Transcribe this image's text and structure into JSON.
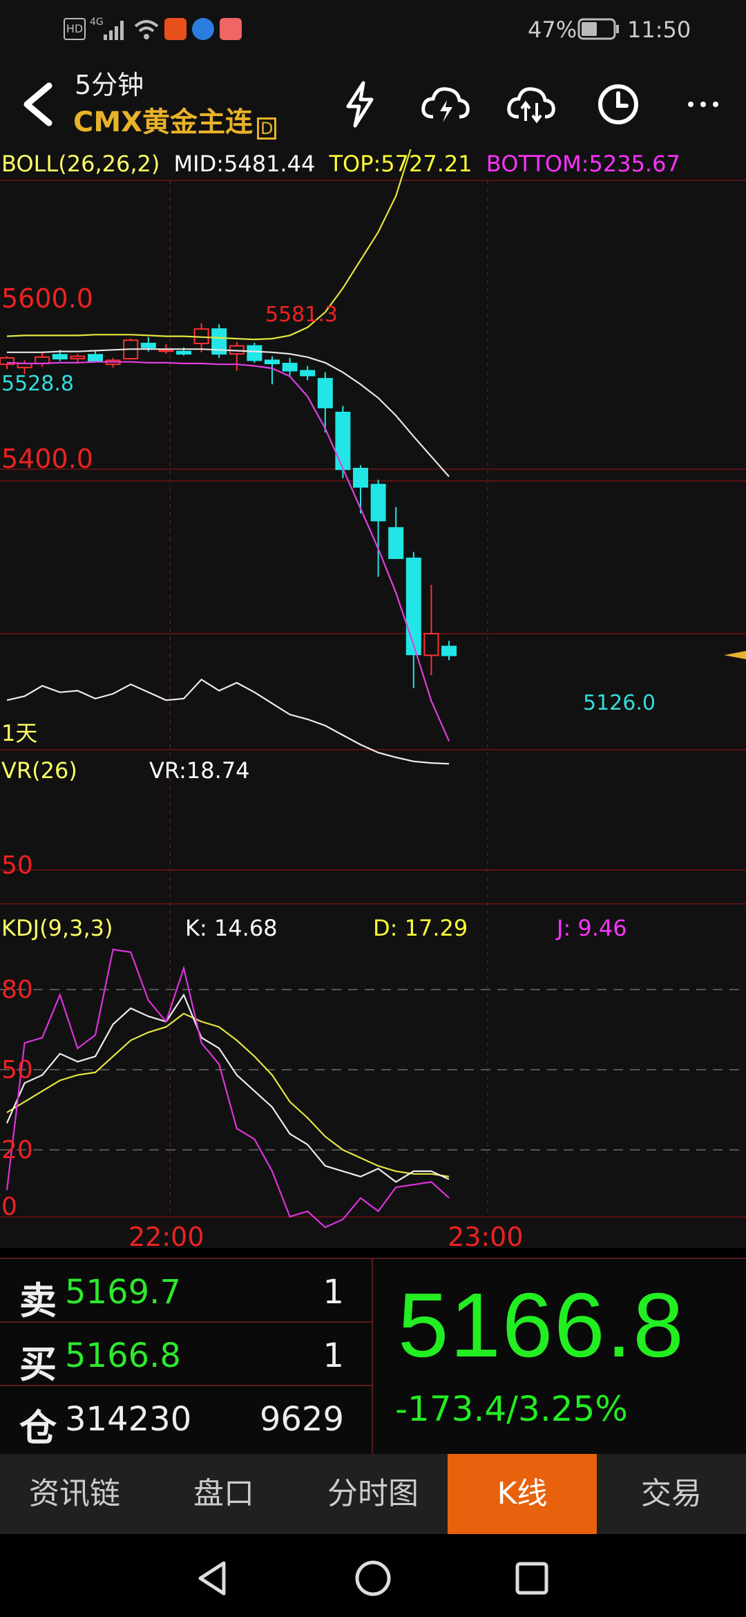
{
  "status_bar": {
    "left_icons": [
      "hd-icon",
      "signal-4g-icon",
      "wifi-icon",
      "app-notification-icon",
      "browser-icon",
      "app-icon"
    ],
    "battery": "47%",
    "time": "11:50"
  },
  "header": {
    "interval": "5分钟",
    "instrument": "CMX黄金主连",
    "badge": "D",
    "buttons": [
      "back-icon",
      "lightning-icon",
      "cloud-lightning-icon",
      "cloud-sync-icon",
      "clock-icon",
      "more-icon"
    ]
  },
  "boll": {
    "title": "BOLL(26,26,2)",
    "mid": "MID:5481.44",
    "top": "TOP:5727.21",
    "bottom": "BOTTOM:5235.67",
    "colors": {
      "title": "#ffff66",
      "mid": "#ffffff",
      "top": "#ffff33",
      "bottom": "#ff33ff"
    }
  },
  "price_axis": {
    "label_5600": "5600.0",
    "label_5400": "5400.0"
  },
  "annotations": {
    "high": "5581.3",
    "left": "5528.8",
    "low": "5126.0"
  },
  "period_label": "1天",
  "vr": {
    "title": "VR(26)",
    "value": "VR:18.74",
    "axis_label": "50"
  },
  "kdj": {
    "title": "KDJ(9,3,3)",
    "k": "K: 14.68",
    "d": "D: 17.29",
    "j": "J: 9.46",
    "axis": [
      "80",
      "50",
      "20",
      "0"
    ]
  },
  "time_axis": [
    "22:00",
    "23:00"
  ],
  "chart_data": {
    "type": "candlestick",
    "series": [
      {
        "name": "BOLL",
        "values": {
          "mid": 5481.44,
          "top": 5727.21,
          "bottom": 5235.67
        }
      },
      {
        "name": "VR",
        "values": {
          "VR": 18.74
        }
      },
      {
        "name": "KDJ",
        "values": {
          "K": 14.68,
          "D": 17.29,
          "J": 9.46
        }
      }
    ],
    "price_ticks": [
      5600.0,
      5400.0
    ],
    "kdj_ticks": [
      80,
      50,
      20,
      0
    ],
    "marked_high": 5581.3,
    "marked_low": 5126.0,
    "candles": [
      {
        "o": 5530,
        "h": 5540,
        "l": 5524,
        "c": 5538
      },
      {
        "o": 5526,
        "h": 5535,
        "l": 5518,
        "c": 5531
      },
      {
        "o": 5531,
        "h": 5545,
        "l": 5527,
        "c": 5539
      },
      {
        "o": 5542,
        "h": 5548,
        "l": 5534,
        "c": 5537
      },
      {
        "o": 5537,
        "h": 5543,
        "l": 5531,
        "c": 5540
      },
      {
        "o": 5542,
        "h": 5546,
        "l": 5532,
        "c": 5534
      },
      {
        "o": 5530,
        "h": 5538,
        "l": 5526,
        "c": 5535
      },
      {
        "o": 5537,
        "h": 5562,
        "l": 5536,
        "c": 5560
      },
      {
        "o": 5556,
        "h": 5564,
        "l": 5546,
        "c": 5551
      },
      {
        "o": 5548,
        "h": 5555,
        "l": 5543,
        "c": 5548
      },
      {
        "o": 5546,
        "h": 5551,
        "l": 5541,
        "c": 5543
      },
      {
        "o": 5556,
        "h": 5581.3,
        "l": 5545,
        "c": 5574
      },
      {
        "o": 5574,
        "h": 5580,
        "l": 5538,
        "c": 5543
      },
      {
        "o": 5543,
        "h": 5558,
        "l": 5522,
        "c": 5553
      },
      {
        "o": 5553,
        "h": 5557,
        "l": 5532,
        "c": 5535
      },
      {
        "o": 5535,
        "h": 5540,
        "l": 5505,
        "c": 5531
      },
      {
        "o": 5531,
        "h": 5538,
        "l": 5516,
        "c": 5522
      },
      {
        "o": 5522,
        "h": 5528,
        "l": 5510,
        "c": 5516
      },
      {
        "o": 5512,
        "h": 5520,
        "l": 5445,
        "c": 5476
      },
      {
        "o": 5470,
        "h": 5478,
        "l": 5388,
        "c": 5399
      },
      {
        "o": 5400,
        "h": 5404,
        "l": 5344,
        "c": 5377
      },
      {
        "o": 5380,
        "h": 5386,
        "l": 5265,
        "c": 5335
      },
      {
        "o": 5326,
        "h": 5352,
        "l": 5305,
        "c": 5288
      },
      {
        "o": 5288,
        "h": 5296,
        "l": 5126.0,
        "c": 5168
      },
      {
        "o": 5167,
        "h": 5255,
        "l": 5142,
        "c": 5194
      },
      {
        "o": 5178,
        "h": 5185,
        "l": 5161,
        "c": 5166.8
      }
    ],
    "boll_upper": [
      5565,
      5566,
      5566,
      5566,
      5566,
      5567,
      5567,
      5567,
      5566,
      5565,
      5565,
      5564,
      5563,
      5562,
      5561,
      5562,
      5566,
      5576,
      5595,
      5625,
      5660,
      5695,
      5740,
      5810,
      5880,
      5940
    ],
    "boll_mid": [
      5545,
      5545,
      5545,
      5546,
      5546,
      5547,
      5548,
      5549,
      5549,
      5549,
      5549,
      5549,
      5548,
      5547,
      5546,
      5545,
      5543,
      5539,
      5532,
      5520,
      5505,
      5488,
      5466,
      5440,
      5415,
      5390
    ],
    "boll_lower": [
      5532,
      5531,
      5531,
      5532,
      5532,
      5533,
      5533,
      5533,
      5532,
      5532,
      5531,
      5531,
      5530,
      5530,
      5528,
      5525,
      5515,
      5490,
      5450,
      5400,
      5350,
      5300,
      5245,
      5180,
      5110,
      5060
    ],
    "vr": [
      150,
      155,
      168,
      160,
      162,
      152,
      158,
      170,
      160,
      150,
      152,
      176,
      162,
      172,
      160,
      146,
      132,
      126,
      118,
      106,
      94,
      84,
      78,
      73,
      71,
      70
    ],
    "kdj_k": [
      30,
      45,
      48,
      56,
      53,
      55,
      67,
      73,
      70,
      68,
      78,
      62,
      58,
      48,
      42,
      36,
      26,
      22,
      14,
      12,
      10,
      13,
      8,
      12,
      12,
      9
    ],
    "kdj_d": [
      34,
      38,
      42,
      46,
      48,
      49,
      55,
      61,
      64,
      66,
      71,
      68,
      66,
      61,
      55,
      48,
      38,
      32,
      25,
      20,
      17,
      14,
      12,
      11,
      11,
      10
    ],
    "kdj_j": [
      5,
      60,
      62,
      78,
      58,
      63,
      95,
      94,
      76,
      68,
      88,
      60,
      52,
      28,
      24,
      12,
      -5,
      -3,
      -9,
      -6,
      2,
      -3,
      6,
      7,
      8,
      2
    ]
  },
  "quote": {
    "sell_label": "卖",
    "sell_price": "5169.7",
    "sell_qty": "1",
    "buy_label": "买",
    "buy_price": "5166.8",
    "buy_qty": "1",
    "oi_label": "仓",
    "oi_value": "314230",
    "oi_change": "9629",
    "last_price": "5166.8",
    "change": "-173.4/3.25%",
    "price_color": "#22ee22"
  },
  "tabs": [
    "资讯链",
    "盘口",
    "分时图",
    "K线",
    "交易"
  ],
  "active_tab": "K线"
}
